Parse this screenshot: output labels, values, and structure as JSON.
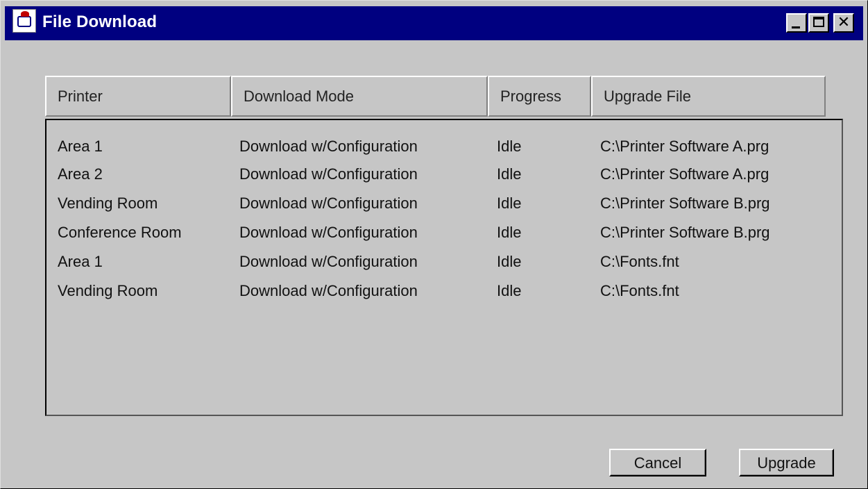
{
  "window": {
    "title": "File Download",
    "icon": "java-cup-icon",
    "controls": [
      "minimize-icon",
      "maximize-icon",
      "close-icon"
    ],
    "close_glyph": "✕"
  },
  "table": {
    "columns": [
      "Printer",
      "Download Mode",
      "Progress",
      "Upgrade File"
    ],
    "rows": [
      [
        "Area 1",
        "Download w/Configuration",
        "Idle",
        "C:\\Printer Software A.prg"
      ],
      [
        "Area 2",
        "Download w/Configuration",
        "Idle",
        "C:\\Printer Software A.prg"
      ],
      [
        "Vending Room",
        "Download w/Configuration",
        "Idle",
        "C:\\Printer Software B.prg"
      ],
      [
        "Conference Room",
        "Download w/Configuration",
        "Idle",
        "C:\\Printer Software B.prg"
      ],
      [
        "Area 1",
        "Download w/Configuration",
        "Idle",
        "C:\\Fonts.fnt"
      ],
      [
        "Vending Room",
        "Download w/Configuration",
        "Idle",
        "C:\\Fonts.fnt"
      ]
    ]
  },
  "buttons": {
    "cancel": "Cancel",
    "upgrade": "Upgrade"
  },
  "colors": {
    "titlebar": "#000080",
    "window_bg": "#c6c6c6"
  }
}
